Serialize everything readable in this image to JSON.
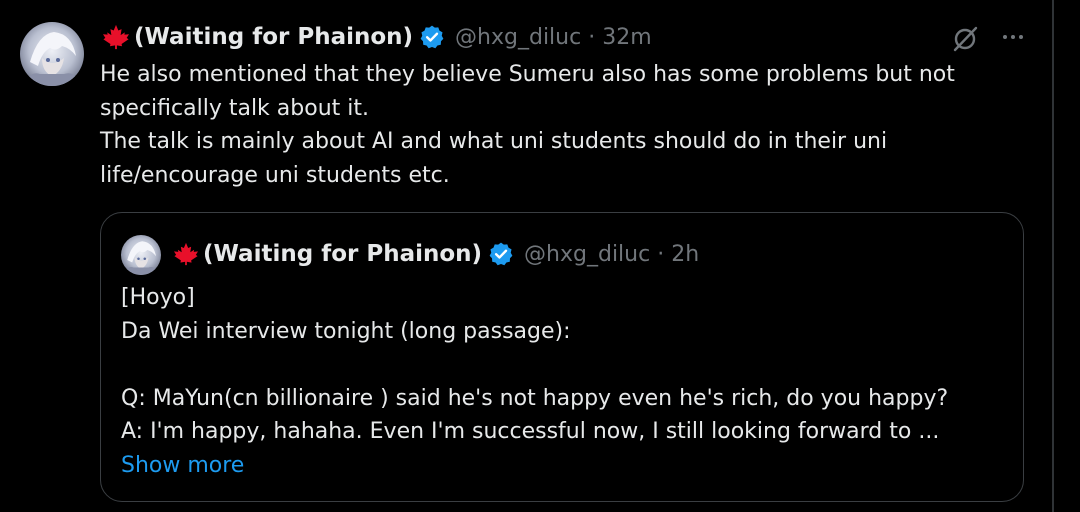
{
  "colors": {
    "background": "#000000",
    "text": "#e7e9ea",
    "muted": "#71767b",
    "link": "#1d9bf0",
    "verified": "#1d9bf0",
    "border": "#2f3336",
    "leaf": "#e8102a"
  },
  "tweet": {
    "display_name": "(Waiting for Phainon)",
    "handle": "@hxg_diluc",
    "separator": "·",
    "time": "32m",
    "icons": [
      "maple-leaf-icon",
      "verified-badge-icon",
      "grok-icon",
      "more-icon"
    ],
    "lines": [
      "He also mentioned that they believe Sumeru also has some problems but not",
      "specifically talk about it.",
      "The talk is mainly about AI and what uni students should do in their uni",
      "life/encourage uni students etc."
    ]
  },
  "quote": {
    "display_name": "(Waiting for Phainon)",
    "handle": "@hxg_diluc",
    "separator": "·",
    "time": "2h",
    "lines": [
      "[Hoyo]",
      "Da Wei interview tonight (long passage):",
      "",
      "Q: MaYun(cn billionaire ) said he's not happy even he's rich, do you happy?",
      "A: I'm happy, hahaha. Even I'm successful now, I still looking forward to ..."
    ],
    "show_more": "Show more"
  }
}
